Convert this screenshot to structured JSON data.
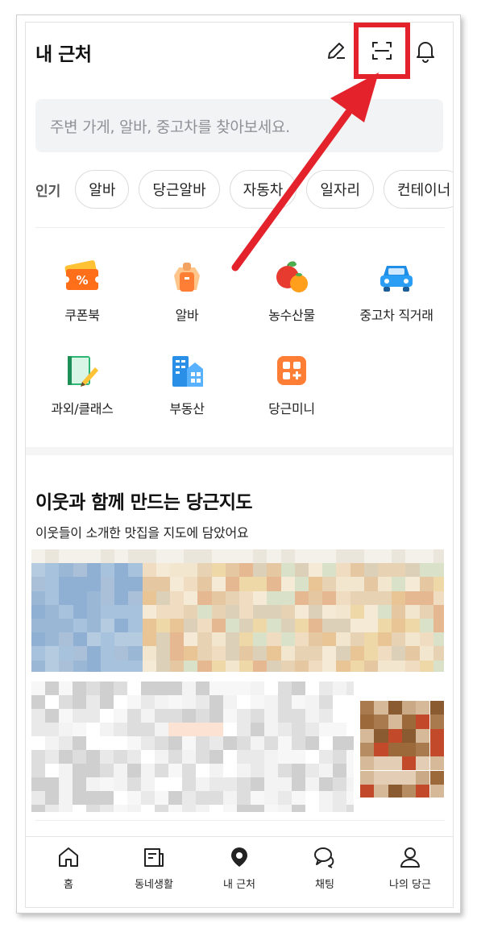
{
  "header": {
    "title": "내 근처",
    "icons": [
      "edit-icon",
      "scan-icon",
      "bell-icon"
    ]
  },
  "search": {
    "placeholder": "주변 가게, 알바, 중고차를 찾아보세요."
  },
  "popular": {
    "label": "인기",
    "chips": [
      "알바",
      "당근알바",
      "자동차",
      "일자리",
      "컨테이너"
    ]
  },
  "categories": [
    {
      "label": "쿠폰북",
      "icon": "coupon-icon"
    },
    {
      "label": "알바",
      "icon": "worker-icon"
    },
    {
      "label": "농수산물",
      "icon": "fruit-icon"
    },
    {
      "label": "중고차 직거래",
      "icon": "car-icon"
    },
    {
      "label": "과외/클래스",
      "icon": "notebook-icon"
    },
    {
      "label": "부동산",
      "icon": "building-icon"
    },
    {
      "label": "당근미니",
      "icon": "mini-app-icon"
    }
  ],
  "map_section": {
    "title": "이웃과 함께 만드는 당근지도",
    "subtitle": "이웃들이 소개한 맛집을 지도에 담았어요"
  },
  "tabbar": {
    "items": [
      {
        "label": "홈",
        "icon": "home-icon"
      },
      {
        "label": "동네생활",
        "icon": "newspaper-icon"
      },
      {
        "label": "내 근처",
        "icon": "location-pin-icon",
        "active": true
      },
      {
        "label": "채팅",
        "icon": "chat-icon"
      },
      {
        "label": "나의 당근",
        "icon": "person-icon"
      }
    ]
  },
  "colors": {
    "accent_red": "#e3222b",
    "carrot_orange": "#ff7e36"
  }
}
